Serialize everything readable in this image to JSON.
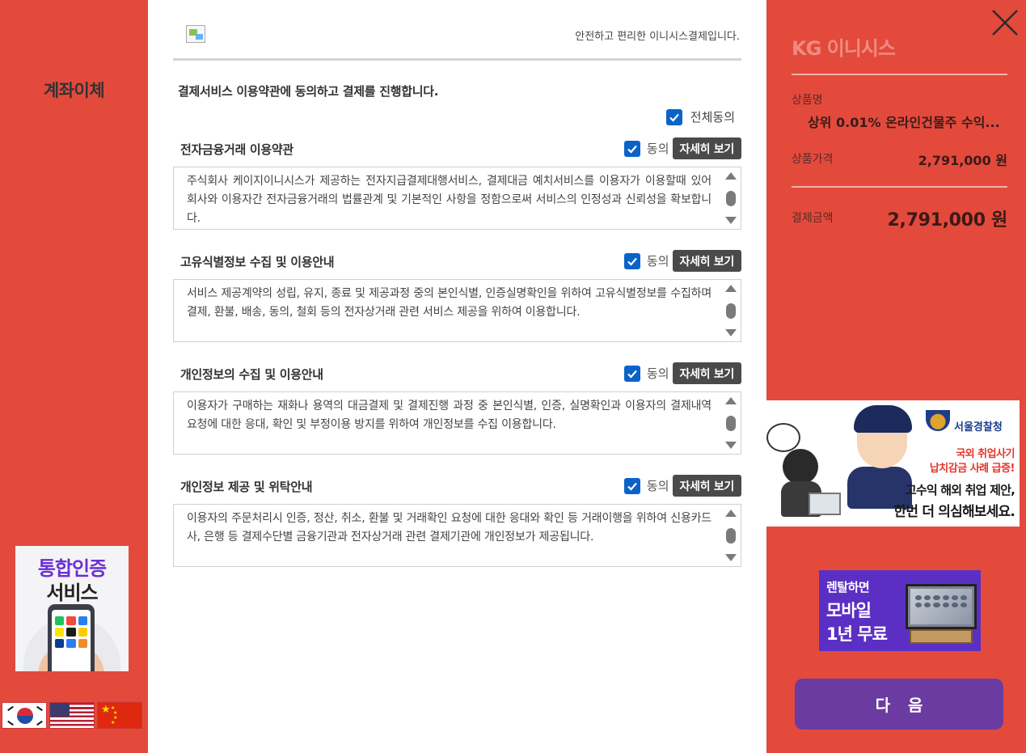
{
  "left": {
    "title": "계좌이체",
    "cert_banner": {
      "line1": "통합인증",
      "line2": "서비스"
    },
    "languages": [
      "korean-flag",
      "us-flag",
      "china-flag"
    ]
  },
  "panel": {
    "tagline": "안전하고 편리한 이니시스결제입니다.",
    "intro": "결제서비스 이용약관에 동의하고 결제를 진행합니다.",
    "all_agree_label": "전체동의",
    "agree_label": "동의",
    "detail_label": "자세히 보기",
    "sections": [
      {
        "title": "전자금융거래 이용약관",
        "checked": true,
        "text": "주식회사 케이지이니시스가 제공하는 전자지급결제대행서비스, 결제대금 예치서비스를 이용자가 이용할때 있어 회사와 이용자간 전자금융거래의 법률관계 및 기본적인 사항을 정함으로써 서비스의 인정성과 신뢰성을 확보합니다."
      },
      {
        "title": "고유식별정보 수집 및 이용안내",
        "checked": true,
        "text": "서비스 제공계약의 성립, 유지, 종료 및 제공과정 중의 본인식별, 인증실명확인을 위하여 고유식별정보를 수집하며 결제, 환불, 배송, 동의, 철회 등의 전자상거래 관련 서비스 제공을 위하여 이용합니다."
      },
      {
        "title": "개인정보의 수집 및 이용안내",
        "checked": true,
        "text": "이용자가 구매하는 재화나 용역의 대금결제 및 결제진행 과정 중 본인식별, 인증, 실명확인과 이용자의 결제내역 요청에 대한 응대, 확인 및 부정이용 방지를 위하여 개인정보를 수집 이용합니다."
      },
      {
        "title": "개인정보 제공 및 위탁안내",
        "checked": true,
        "text": "이용자의 주문처리시 인증, 정산, 취소, 환불 및 거래확인 요청에 대한 응대와 확인 등 거래이행을 위하여 신용카드사, 은행 등 결제수단별 금융기관과 전자상거래 관련 결제기관에 개인정보가 제공됩니다."
      }
    ]
  },
  "right": {
    "logo": "KG 이니시스",
    "product_label": "상품명",
    "product_name": "상위 0.01% 온라인건물주 수익...",
    "price_label": "상품가격",
    "price": "2,791,000 원",
    "total_label": "결제금액",
    "total": "2,791,000 원",
    "police_banner": {
      "org": "서울경찰청",
      "line1": "국외 취업사기",
      "line2": "납치감금 사례 급증!",
      "line3": "고수익 해외 취업 제안,",
      "line4": "한번 더 의심해보세요."
    },
    "rental_banner": {
      "line1": "렌탈하면",
      "line2": "모바일",
      "line3": "1년 무료"
    },
    "next_label": "다음"
  },
  "colors": {
    "background": "#e34a3c",
    "checkbox": "#0b63c9",
    "next_button": "#6b3ba1",
    "detail_button": "#4a4a4a"
  }
}
